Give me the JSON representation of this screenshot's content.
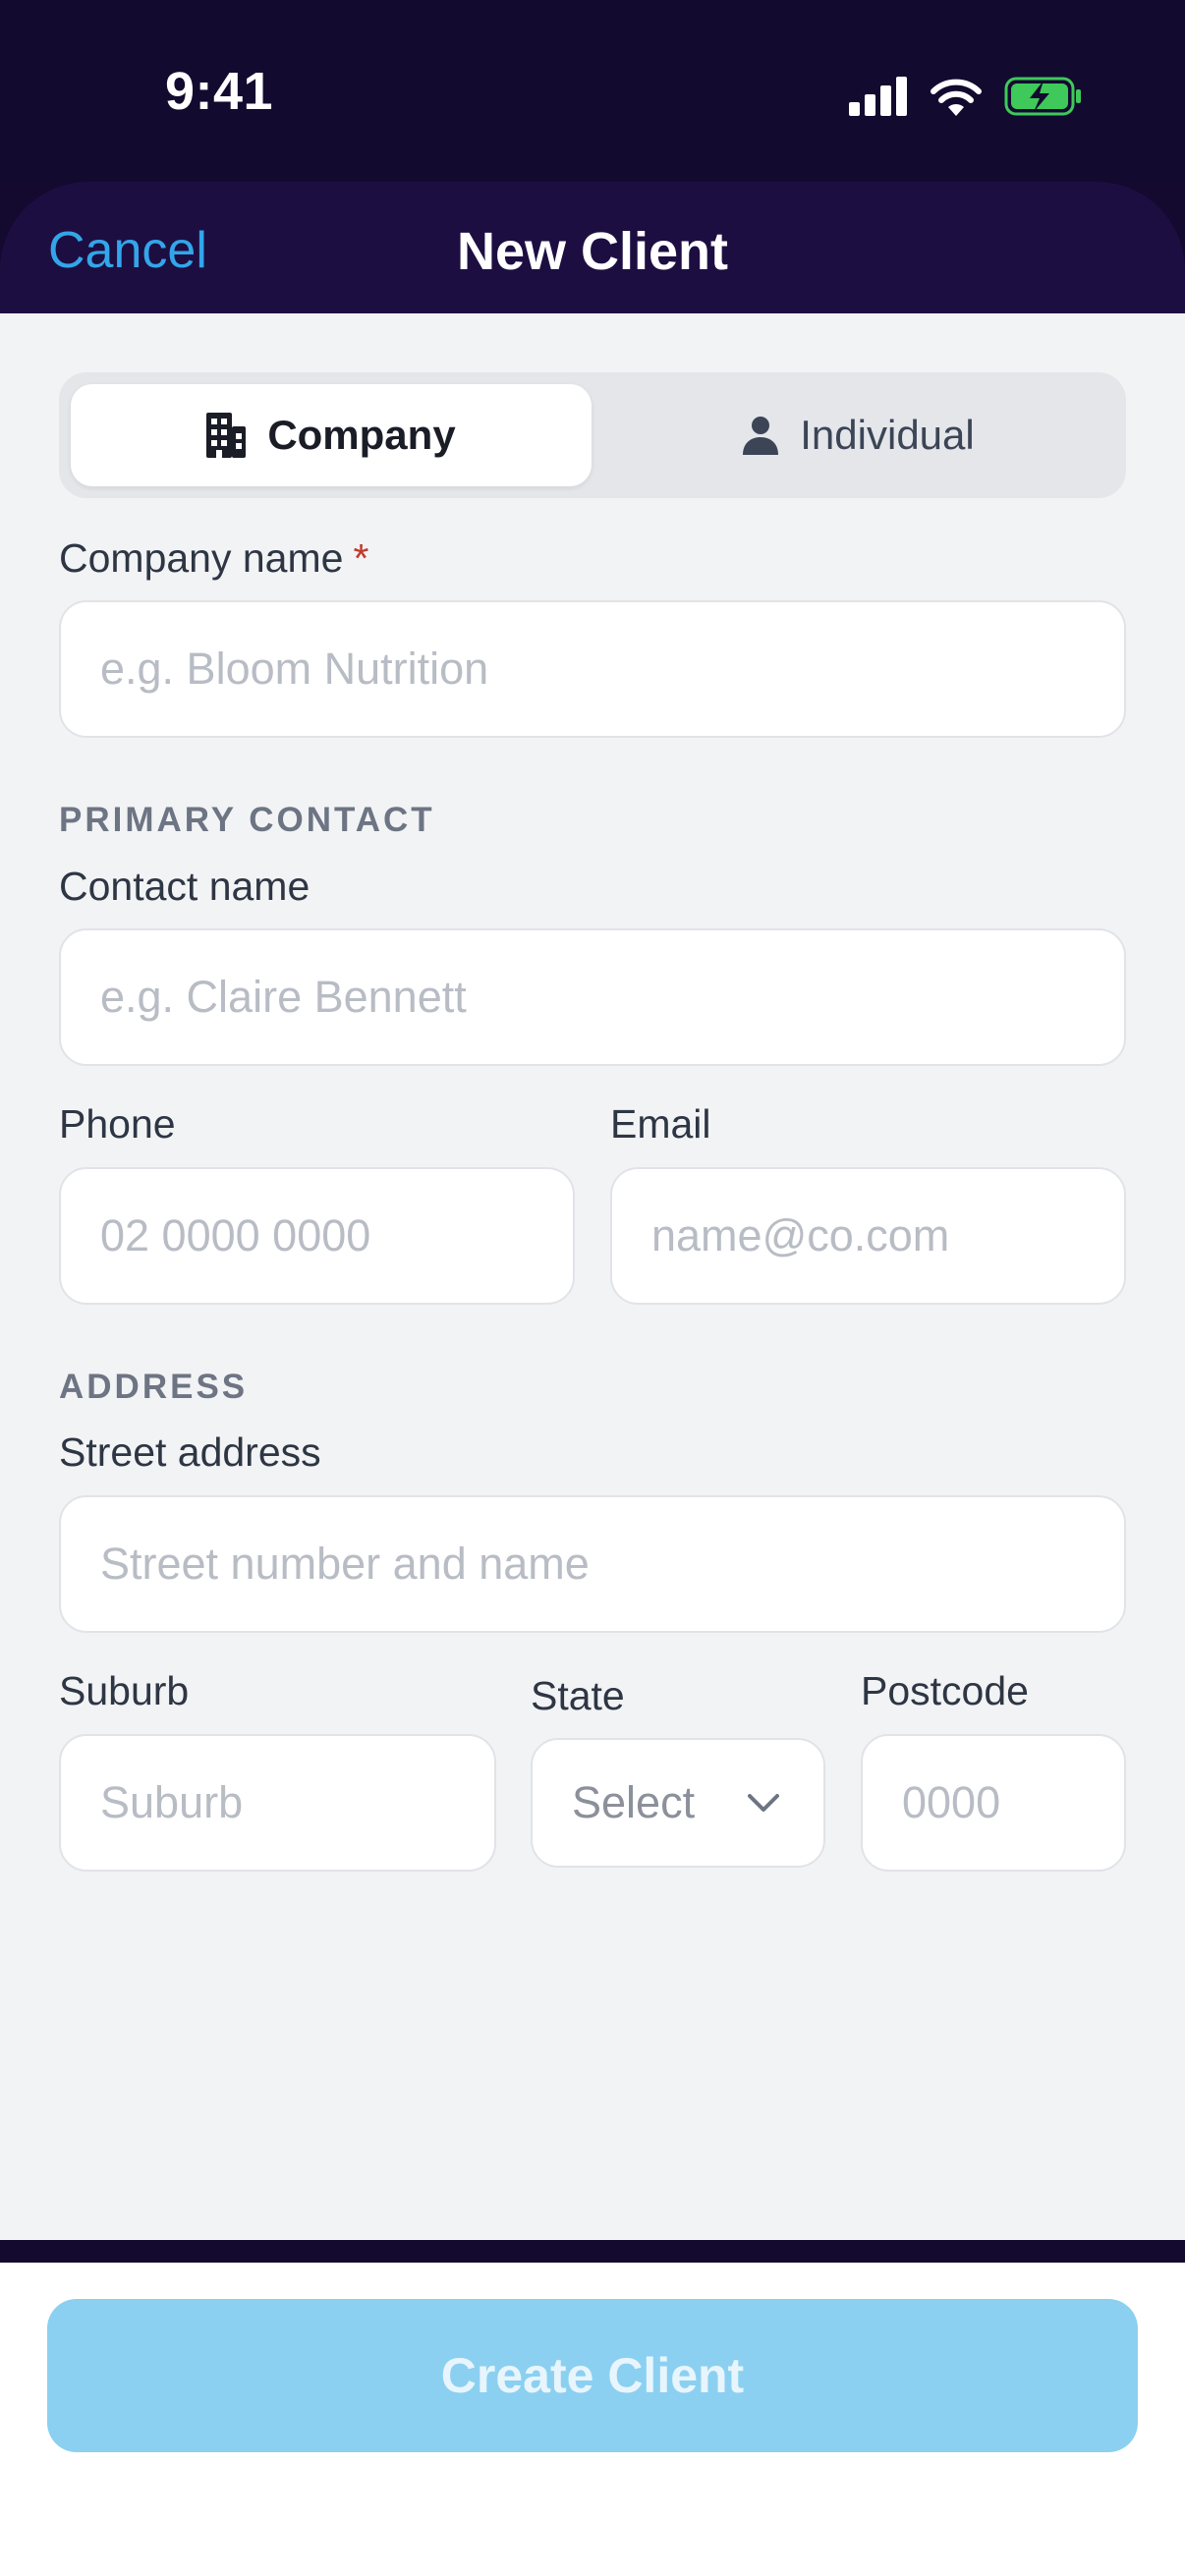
{
  "status": {
    "time": "9:41"
  },
  "nav": {
    "cancel": "Cancel",
    "title": "New Client"
  },
  "segment": {
    "company": "Company",
    "individual": "Individual",
    "selected": "Company"
  },
  "company_name": {
    "label": "Company name",
    "required_mark": "*",
    "placeholder": "e.g. Bloom Nutrition"
  },
  "primary_contact": {
    "heading": "PRIMARY CONTACT",
    "contact_name": {
      "label": "Contact name",
      "placeholder": "e.g. Claire Bennett"
    },
    "phone": {
      "label": "Phone",
      "placeholder": "02 0000 0000"
    },
    "email": {
      "label": "Email",
      "placeholder": "name@co.com"
    }
  },
  "address": {
    "heading": "ADDRESS",
    "street": {
      "label": "Street address",
      "placeholder": "Street number and name"
    },
    "suburb": {
      "label": "Suburb",
      "placeholder": "Suburb"
    },
    "state": {
      "label": "State",
      "value": "Select"
    },
    "postcode": {
      "label": "Postcode",
      "placeholder": "0000"
    }
  },
  "footer": {
    "create_button": "Create Client"
  },
  "colors": {
    "accent": "#33a6ea",
    "button_disabled": "#8bd0f1",
    "header_bg": "#130a2f",
    "battery": "#3ec95a"
  }
}
